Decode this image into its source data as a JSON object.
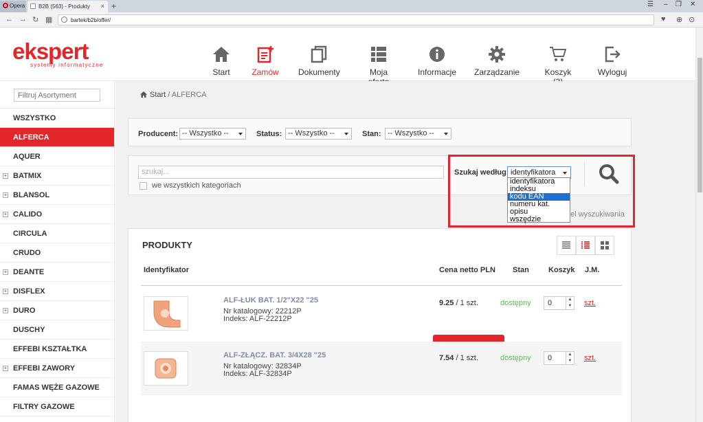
{
  "browser": {
    "opera_tab": "Opera",
    "tab_title": "B2B (563) - Produkty",
    "tab_close": "×",
    "new_tab": "+",
    "url": "bartek/b2b/offer/"
  },
  "header": {
    "logo_main": "ekspert",
    "logo_sub": "systemy informatyczne",
    "menu": [
      {
        "label": "Start",
        "icon": "home-icon"
      },
      {
        "label": "Zamów",
        "icon": "order-icon"
      },
      {
        "label": "Dokumenty",
        "icon": "documents-icon"
      },
      {
        "label": "Moja oferta",
        "icon": "list-icon"
      },
      {
        "label": "Informacje",
        "icon": "info-icon"
      },
      {
        "label": "Zarządzanie",
        "icon": "gear-icon"
      },
      {
        "label": "Koszyk (3)",
        "icon": "cart-icon"
      },
      {
        "label": "Wyloguj",
        "icon": "logout-icon"
      }
    ]
  },
  "sidebar": {
    "filter_placeholder": "Filtruj Asortyment",
    "items": [
      {
        "label": "WSZYSTKO",
        "expandable": false,
        "active": false
      },
      {
        "label": "ALFERCA",
        "expandable": false,
        "active": true
      },
      {
        "label": "AQUER",
        "expandable": false,
        "active": false
      },
      {
        "label": "BATMIX",
        "expandable": true,
        "active": false
      },
      {
        "label": "BLANSOL",
        "expandable": true,
        "active": false
      },
      {
        "label": "CALIDO",
        "expandable": true,
        "active": false
      },
      {
        "label": "CIRCULA",
        "expandable": false,
        "active": false
      },
      {
        "label": "CRUDO",
        "expandable": false,
        "active": false
      },
      {
        "label": "DEANTE",
        "expandable": true,
        "active": false
      },
      {
        "label": "DISFLEX",
        "expandable": true,
        "active": false
      },
      {
        "label": "DURO",
        "expandable": true,
        "active": false
      },
      {
        "label": "DUSCHY",
        "expandable": false,
        "active": false
      },
      {
        "label": "EFFEBI KSZTAŁTKA",
        "expandable": false,
        "active": false
      },
      {
        "label": "EFFEBI ZAWORY",
        "expandable": true,
        "active": false
      },
      {
        "label": "FAMAS WĘŻE GAZOWE",
        "expandable": false,
        "active": false
      },
      {
        "label": "FILTRY GAZOWE",
        "expandable": false,
        "active": false
      }
    ]
  },
  "breadcrumb": {
    "start": "Start",
    "separator": " / ",
    "current": "ALFERCA"
  },
  "filters": {
    "producent_label": "Producent:",
    "producent_value": "-- Wszystko --",
    "status_label": "Status:",
    "status_value": "-- Wszystko --",
    "stan_label": "Stan:",
    "stan_value": "-- Wszystko --"
  },
  "search": {
    "placeholder": "szukaj...",
    "all_categories_label": "we wszystkich kategoriach",
    "by_label": "Szukaj według:",
    "by_value": "identyfikatora",
    "options": [
      "identyfikatora",
      "indeksu",
      "kodu EAN",
      "numeru kat.",
      "opisu",
      "wszędzie"
    ],
    "highlighted_option": "kodu EAN",
    "panel_toggle_text": "nel wyszukiwania"
  },
  "products": {
    "title": "PRODUKTY",
    "columns": {
      "id": "Identyfikator",
      "price": "Cena netto PLN",
      "stock": "Stan",
      "cart": "Koszyk",
      "unit": "J.M."
    },
    "rows": [
      {
        "name": "ALF-ŁUK BAT. 1/2\"X22 \"25",
        "catalog": "Nr katalogowy: 22212P",
        "index": "Indeks: ALF-22212P",
        "price": "9.25",
        "per": " / 1 szt.",
        "stock": "dostępny",
        "qty": "0",
        "unit": "szt."
      },
      {
        "name": "ALF-ZŁĄCZ. BAT. 3/4X28 \"25",
        "catalog": "Nr katalogowy: 32834P",
        "index": "Indeks: ALF-32834P",
        "price": "7.54",
        "per": " / 1 szt.",
        "stock": "dostępny",
        "qty": "0",
        "unit": "szt."
      }
    ]
  },
  "colors": {
    "brand": "#e4262a",
    "stock_ok": "#5cb85c",
    "highlight": "#1e6fd0"
  }
}
